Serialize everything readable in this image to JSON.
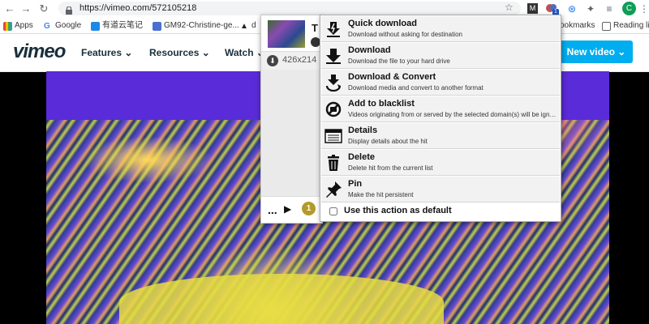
{
  "browser": {
    "url": "https://vimeo.com/572105218",
    "bookmarks": [
      {
        "label": "Apps",
        "color": "#e8453c"
      },
      {
        "label": "Google",
        "color": "#4285f4"
      },
      {
        "label": "有道云笔记",
        "color": "#1e88e5"
      },
      {
        "label": "GM92-Christine-ge...",
        "color": "#4a6fd1"
      },
      {
        "label": "d",
        "color": "#222222"
      }
    ],
    "bookmarks_right": "ookmarks",
    "reading_list": "Reading lis",
    "extension_badge": "1",
    "avatar_letter": "C"
  },
  "vimeo": {
    "logo": "vimeo",
    "nav": [
      "Features ⌄",
      "Resources ⌄",
      "Watch ⌄"
    ],
    "new_video": "New video ⌄"
  },
  "popup": {
    "hit_title": "T",
    "resolution": "426x214",
    "more": "...",
    "play": "▶",
    "count": "1"
  },
  "menu": {
    "items": [
      {
        "title": "Quick download",
        "desc": "Download without asking for destination",
        "icon": "quick-download-icon"
      },
      {
        "title": "Download",
        "desc": "Download the file to your hard drive",
        "icon": "download-icon"
      },
      {
        "title": "Download & Convert",
        "desc": "Download media and convert to another format",
        "icon": "convert-icon"
      },
      {
        "title": "Add to blacklist",
        "desc": "Videos originating from or served by the selected domain(s) will be ignor...",
        "icon": "blacklist-icon"
      },
      {
        "title": "Details",
        "desc": "Display details about the hit",
        "icon": "details-icon"
      },
      {
        "title": "Delete",
        "desc": "Delete hit from the current list",
        "icon": "trash-icon"
      },
      {
        "title": "Pin",
        "desc": "Make the hit persistent",
        "icon": "pin-icon"
      }
    ],
    "default_label": "Use this action as default"
  }
}
